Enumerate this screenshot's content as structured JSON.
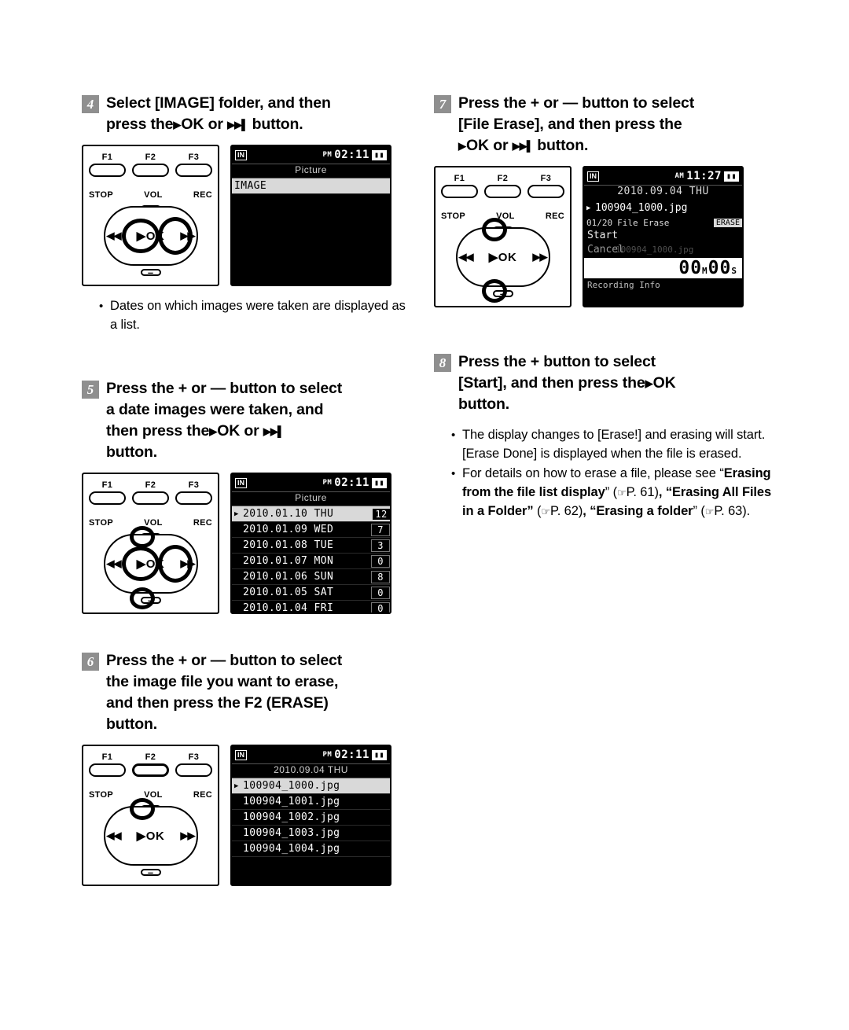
{
  "steps": {
    "step4": {
      "num": "4",
      "line1_a": "Select [IMAGE] folder, and then",
      "line2_a": "press the",
      "line2_ok": "OK",
      "line2_or": "or",
      "line2_b": "button.",
      "bullets": [
        "Dates on which images were taken are displayed as a list."
      ]
    },
    "step5": {
      "num": "5",
      "line1": "Press the + or — button to select",
      "line2": "a date images were taken, and",
      "line3_a": "then press the",
      "line3_ok": "OK",
      "line3_or": "or",
      "line4": "button."
    },
    "step6": {
      "num": "6",
      "line1": "Press the + or — button to select",
      "line2": "the image file you want to erase,",
      "line3": "and then press the F2 (ERASE)",
      "line4": "button."
    },
    "step7": {
      "num": "7",
      "line1": "Press the + or — button to select",
      "line2": "[File Erase], and then press the",
      "line3_ok": "OK",
      "line3_or": "or",
      "line3_b": "button."
    },
    "step8": {
      "num": "8",
      "line1": "Press the + button to select",
      "line2_a": "[Start], and then press the",
      "line2_ok": "OK",
      "line3": "button.",
      "bullets": [
        "The display changes to [Erase!] and erasing will start. [Erase Done] is displayed when the file is erased.",
        "For details on how to erase a file, please see “Erasing from the file list display” (P. 61), “Erasing All Files in a Folder” (P. 62), “Erasing a folder” (P. 63)."
      ],
      "bullet2_parts": {
        "plain1": "For details on how to erase a file, please see “",
        "bold1": "Erasing from the file list display",
        "ref1": "P. 61",
        "mid1": ", “",
        "bold2": "Erasing All Files in a Folder",
        "ref2": "P. 62",
        "mid2": ", “",
        "bold3": "Erasing a folder",
        "ref3": "P. 63",
        "tail": ")."
      }
    }
  },
  "device": {
    "f_labels": [
      "F1",
      "F2",
      "F3"
    ],
    "stop_label": "STOP",
    "vol_label": "VOL",
    "rec_label": "REC",
    "ok_label": "OK",
    "plus_label": "+",
    "minus_label": "–",
    "rew_label": "◀◀",
    "ff_label": "▶▶"
  },
  "lcd4": {
    "in": "IN",
    "ampm": "PM",
    "time": "02:11",
    "battery": "▮▮",
    "title": "Picture",
    "rows": [
      {
        "label": "IMAGE",
        "count": "",
        "selected": true
      }
    ]
  },
  "lcd5": {
    "in": "IN",
    "ampm": "PM",
    "time": "02:11",
    "battery": "▮▮",
    "title": "Picture",
    "rows": [
      {
        "label": "2010.01.10 THU",
        "count": "12",
        "selected": true
      },
      {
        "label": "2010.01.09 WED",
        "count": "7",
        "selected": false
      },
      {
        "label": "2010.01.08 TUE",
        "count": "3",
        "selected": false
      },
      {
        "label": "2010.01.07 MON",
        "count": "0",
        "selected": false
      },
      {
        "label": "2010.01.06 SUN",
        "count": "8",
        "selected": false
      },
      {
        "label": "2010.01.05 SAT",
        "count": "0",
        "selected": false
      },
      {
        "label": "2010.01.04 FRI",
        "count": "0",
        "selected": false
      }
    ]
  },
  "lcd6": {
    "in": "IN",
    "ampm": "PM",
    "time": "02:11",
    "battery": "▮▮",
    "title": "2010.09.04 THU",
    "rows": [
      {
        "label": "100904_1000.jpg",
        "selected": true
      },
      {
        "label": "100904_1001.jpg",
        "selected": false
      },
      {
        "label": "100904_1002.jpg",
        "selected": false
      },
      {
        "label": "100904_1003.jpg",
        "selected": false
      },
      {
        "label": "100904_1004.jpg",
        "selected": false
      }
    ]
  },
  "lcd7": {
    "in": "IN",
    "ampm": "AM",
    "time": "11:27",
    "battery": "▮▮",
    "title": "2010.09.04 THU",
    "file": "100904_1000.jpg",
    "menu_index": "01/20",
    "menu_label": "File Erase",
    "menu_badge": "ERASE",
    "options": [
      "Start",
      "Cancel"
    ],
    "ghost_file": "100904_1000.jpg",
    "big_time": "00",
    "big_time_unit_h": "M",
    "big_time_2": "00",
    "big_time_unit_s": "S",
    "rec_info": "Recording Info"
  }
}
